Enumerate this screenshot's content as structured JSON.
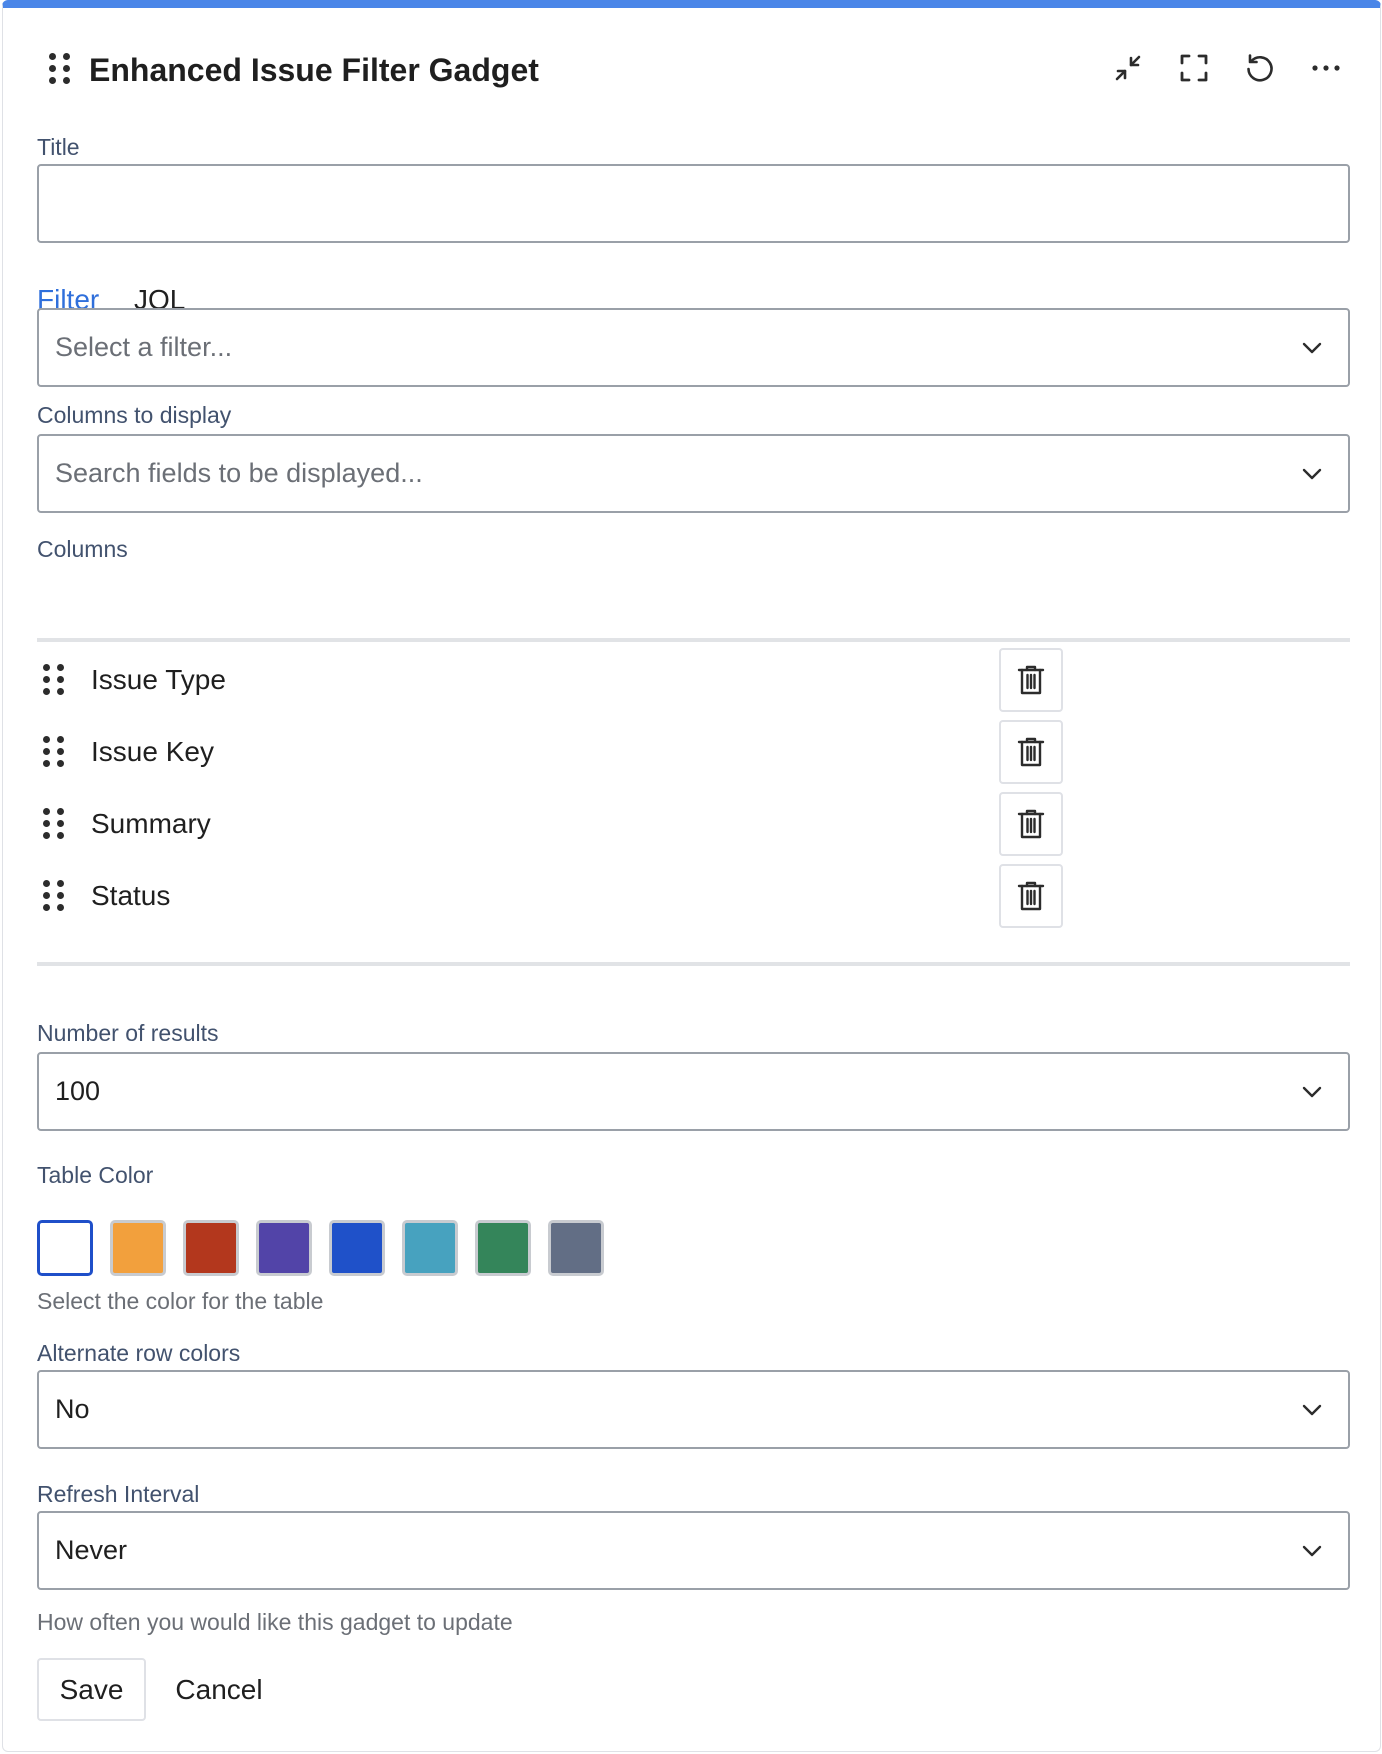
{
  "gadget": {
    "title": "Enhanced Issue Filter Gadget",
    "header_icons": [
      "minimize-icon",
      "fullscreen-icon",
      "refresh-icon",
      "more-options-icon"
    ],
    "accent_color": "#4a86e8"
  },
  "form": {
    "title_label": "Title",
    "title_value": "",
    "tabs": [
      {
        "label": "Filter",
        "active": true
      },
      {
        "label": "JQL",
        "active": false
      }
    ],
    "filter_select": {
      "placeholder": "Select a filter..."
    },
    "columns_to_display": {
      "label": "Columns to display",
      "placeholder": "Search fields to be displayed..."
    },
    "columns": {
      "label": "Columns",
      "items": [
        {
          "name": "Issue Type"
        },
        {
          "name": "Issue Key"
        },
        {
          "name": "Summary"
        },
        {
          "name": "Status"
        }
      ]
    },
    "number_of_results": {
      "label": "Number of results",
      "value": "100"
    },
    "table_color": {
      "label": "Table Color",
      "helper": "Select the color for the table",
      "options": [
        {
          "color": "#ffffff",
          "selected": true
        },
        {
          "color": "#f2a03d",
          "selected": false
        },
        {
          "color": "#b3371d",
          "selected": false
        },
        {
          "color": "#5244a8",
          "selected": false
        },
        {
          "color": "#1f51c9",
          "selected": false
        },
        {
          "color": "#47a2bf",
          "selected": false
        },
        {
          "color": "#34855a",
          "selected": false
        },
        {
          "color": "#626e85",
          "selected": false
        }
      ]
    },
    "alternate_row_colors": {
      "label": "Alternate row colors",
      "value": "No"
    },
    "refresh_interval": {
      "label": "Refresh Interval",
      "value": "Never",
      "helper": "How often you would like this gadget to update"
    },
    "save_label": "Save",
    "cancel_label": "Cancel"
  }
}
